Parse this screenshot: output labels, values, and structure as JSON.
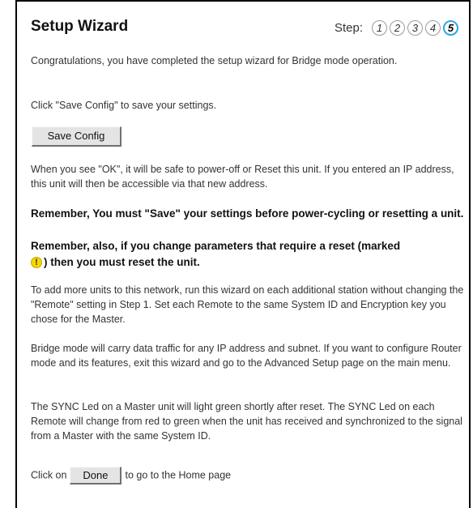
{
  "header": {
    "title": "Setup Wizard",
    "step_label": "Step:",
    "steps": [
      "1",
      "2",
      "3",
      "4",
      "5"
    ],
    "current_step": "5"
  },
  "content": {
    "congrats": "Congratulations, you have completed the setup wizard for Bridge mode operation.",
    "click_save": "Click \"Save Config\" to save your settings.",
    "save_button": "Save Config",
    "ok_note": "When you see \"OK\", it will be safe to power-off or Reset this unit. If you entered an IP address, this unit will then be accessible via that new address.",
    "remember1": "Remember, You must \"Save\" your settings before power-cycling or resetting a unit.",
    "remember2_a": "Remember, also, if you change parameters that require a reset (marked",
    "remember2_icon": "!",
    "remember2_b": ") then you must reset the unit.",
    "add_units": "To add more units to this network, run this wizard on each additional station without changing the \"Remote\" setting in Step 1. Set each Remote to the same System ID and Encryption key you chose for the Master.",
    "bridge_mode": "Bridge mode will carry data traffic for any IP address and subnet. If you want to configure Router mode and its features, exit this wizard and go to the Advanced Setup page on the main menu.",
    "sync_led": "The SYNC Led on a Master unit will light green shortly after reset. The SYNC Led on each Remote will change from red to green when the unit has received and synchronized to the signal from a Master with the same System ID.",
    "click_on": "Click on",
    "done_button": "Done",
    "to_home": "to go to the Home page"
  },
  "colors": {
    "active_step_ring": "#2aa7e8",
    "warning_icon": "#f5d800"
  }
}
